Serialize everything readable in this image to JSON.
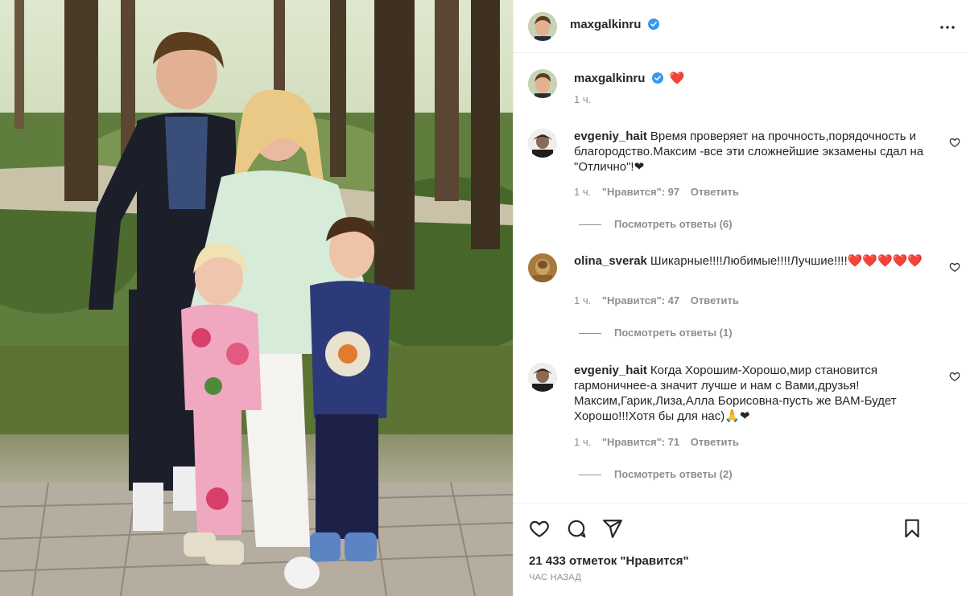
{
  "post": {
    "photo_alt": "",
    "author": {
      "username": "maxgalkinru",
      "verified": true,
      "icon": "verified-badge-icon"
    },
    "caption": {
      "username": "maxgalkinru",
      "text": "❤️",
      "time": "1 ч."
    },
    "comments": [
      {
        "username": "evgeniy_hait",
        "text": "Время проверяет на прочность,порядочность и благородство.Максим -все эти сложнейшие экзамены сдал на \"Отлично\"!❤",
        "time": "1 ч.",
        "likes": "\"Нравится\": 97",
        "reply": "Ответить",
        "view_replies": "Посмотреть ответы (6)"
      },
      {
        "username": "olina_sverak",
        "text": "Шикарные!!!!Любимые!!!!Лучшие!!!!❤️❤️❤️❤️❤️",
        "time": "1 ч.",
        "likes": "\"Нравится\": 47",
        "reply": "Ответить",
        "view_replies": "Посмотреть ответы (1)"
      },
      {
        "username": "evgeniy_hait",
        "text": "Когда Хорошим-Хорошо,мир становится гармоничнее-а значит лучше и нам с Вами,друзья! Максим,Гарик,Лиза,Алла Борисовна-пусть же ВАМ-Будет Хорошо!!!Хотя бы для нас)🙏❤",
        "time": "1 ч.",
        "likes": "\"Нравится\": 71",
        "reply": "Ответить",
        "view_replies": "Посмотреть ответы (2)"
      }
    ],
    "actions": {
      "like_icon": "heart-icon",
      "comment_icon": "comment-icon",
      "share_icon": "share-icon",
      "save_icon": "bookmark-icon"
    },
    "likes_count": "21 433 отметок \"Нравится\"",
    "posted_ago": "ЧАС НАЗАД"
  },
  "colors": {
    "text": "#262626",
    "muted": "#8e8e8e",
    "verified": "#3897f0",
    "border": "#efefef"
  }
}
